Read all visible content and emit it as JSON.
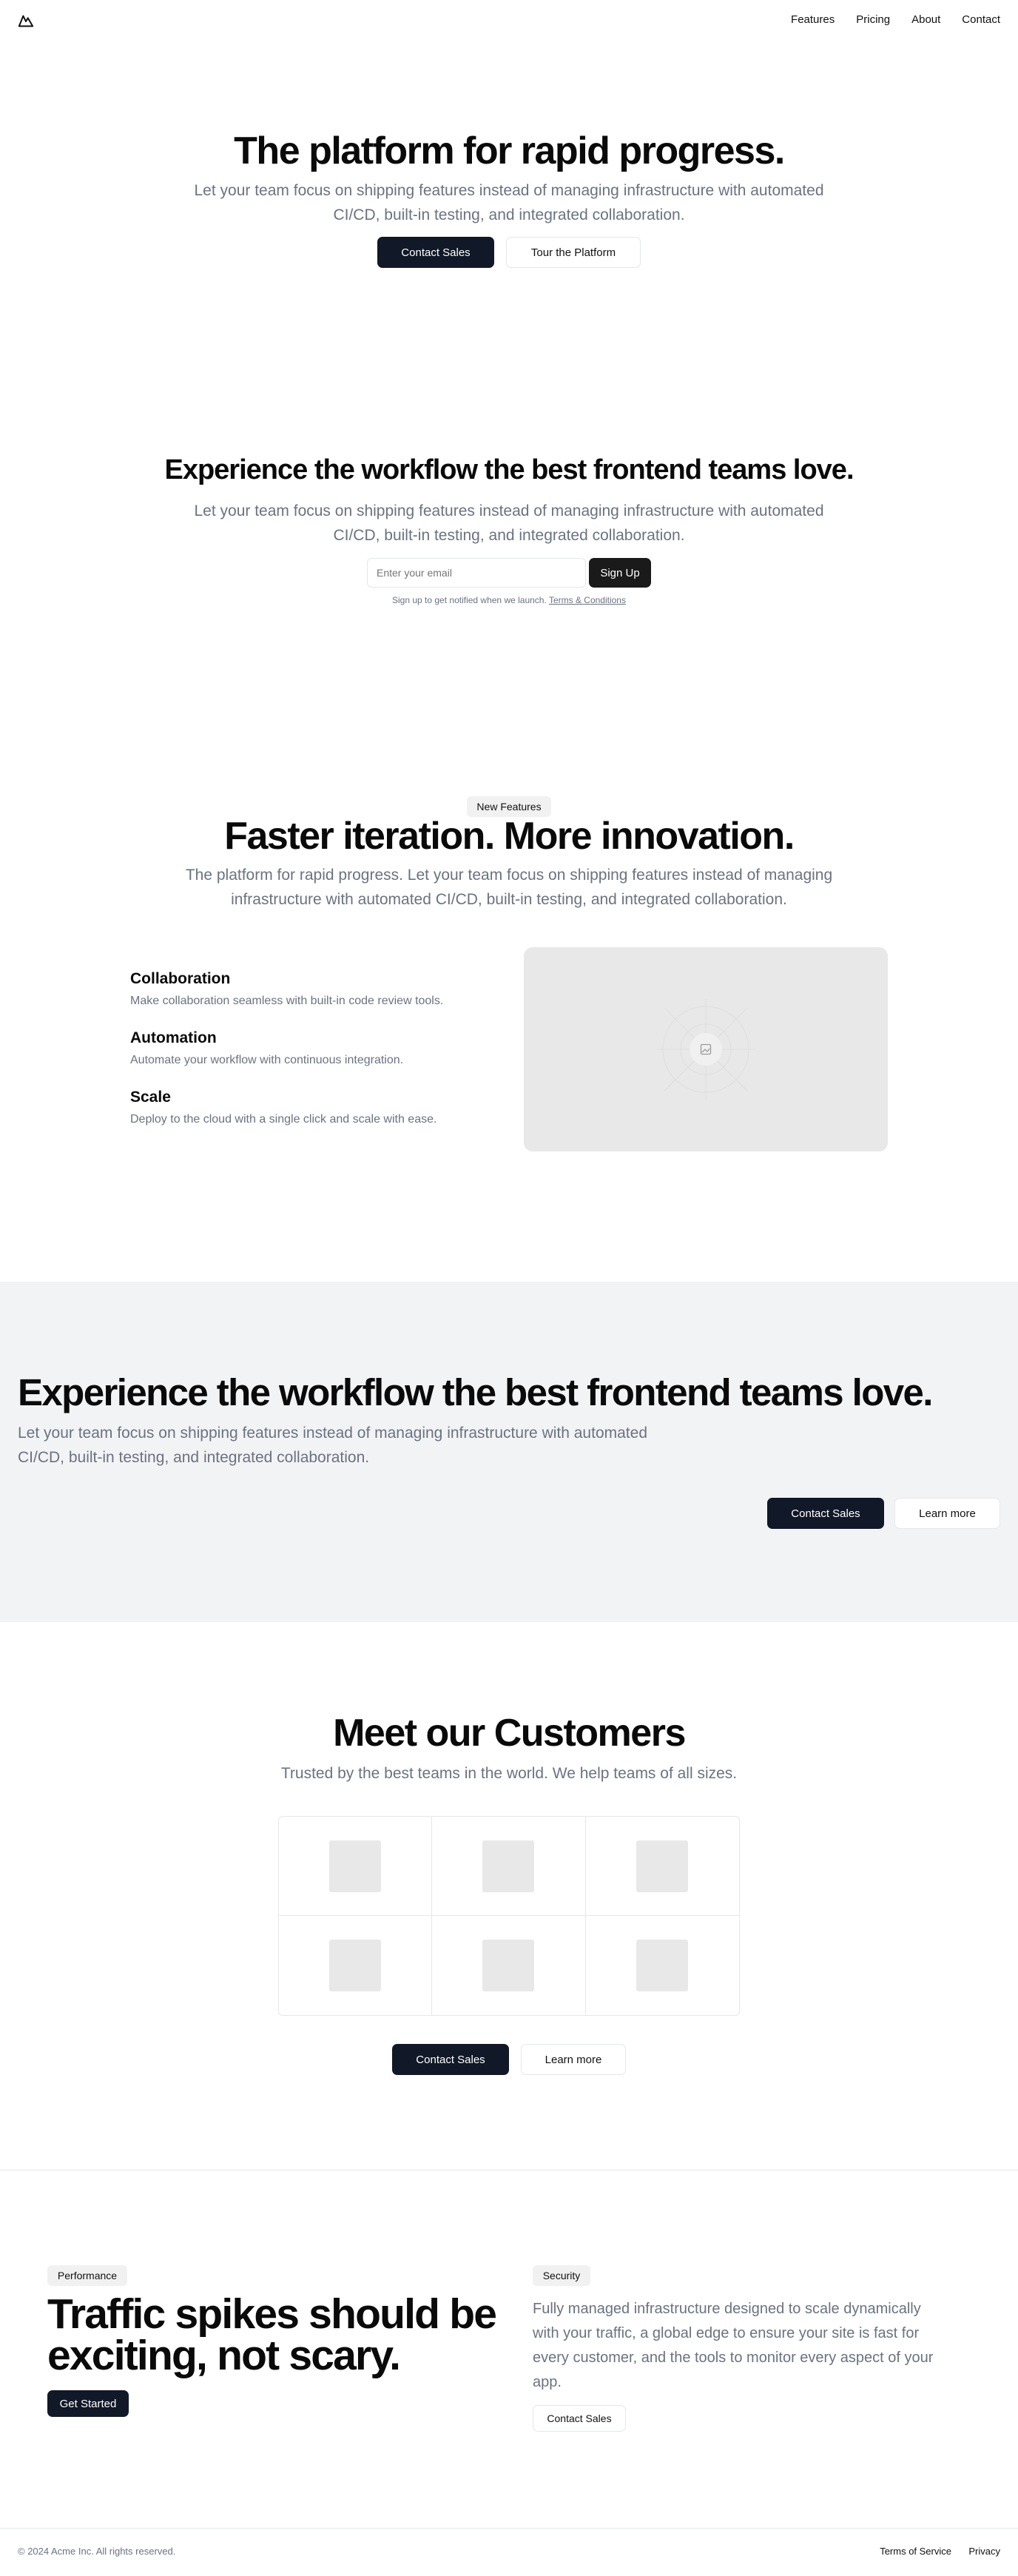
{
  "header": {
    "logo_icon": "mountain-logo-icon",
    "nav": [
      "Features",
      "Pricing",
      "About",
      "Contact"
    ]
  },
  "hero": {
    "title": "The platform for rapid progress.",
    "subtitle_line1": "Let your team focus on shipping features instead of managing infrastructure with automated",
    "subtitle_line2": "CI/CD, built-in testing, and integrated collaboration.",
    "primary_cta": "Contact Sales",
    "secondary_cta": "Tour the Platform"
  },
  "signup": {
    "title": "Experience the workflow the best frontend teams love.",
    "subtitle_line1": "Let your team focus on shipping features instead of managing infrastructure with automated",
    "subtitle_line2": "CI/CD, built-in testing, and integrated collaboration.",
    "email_placeholder": "Enter your email",
    "button": "Sign Up",
    "note": "Sign up to get notified when we launch.",
    "terms_link": "Terms & Conditions"
  },
  "features": {
    "badge": "New Features",
    "title": "Faster iteration. More innovation.",
    "subtitle_line1": "The platform for rapid progress. Let your team focus on shipping features instead of managing",
    "subtitle_line2": "infrastructure with automated CI/CD, built-in testing, and integrated collaboration.",
    "items": [
      {
        "title": "Collaboration",
        "desc": "Make collaboration seamless with built-in code review tools."
      },
      {
        "title": "Automation",
        "desc": "Automate your workflow with continuous integration."
      },
      {
        "title": "Scale",
        "desc": "Deploy to the cloud with a single click and scale with ease."
      }
    ],
    "image_icon": "image-placeholder-icon"
  },
  "cta_band": {
    "title": "Experience the workflow the best frontend teams love.",
    "subtitle_line1": "Let your team focus on shipping features instead of managing infrastructure with automated",
    "subtitle_line2": "CI/CD, built-in testing, and integrated collaboration.",
    "primary_cta": "Contact Sales",
    "secondary_cta": "Learn more"
  },
  "customers": {
    "title": "Meet our Customers",
    "subtitle": "Trusted by the best teams in the world. We help teams of all sizes.",
    "primary_cta": "Contact Sales",
    "secondary_cta": "Learn more"
  },
  "performance": {
    "badge": "Performance",
    "title_line1": "Traffic spikes should be",
    "title_line2": "exciting, not scary.",
    "cta": "Get Started"
  },
  "security": {
    "badge": "Security",
    "desc_line1": "Fully managed infrastructure designed to scale dynamically",
    "desc_line2": "with your traffic, a global edge to ensure your site is fast for",
    "desc_line3": "every customer, and the tools to monitor every aspect of your",
    "desc_line4": "app.",
    "cta": "Contact Sales"
  },
  "footer": {
    "copyright": "© 2024 Acme Inc. All rights reserved.",
    "links": [
      "Terms of Service",
      "Privacy"
    ]
  }
}
